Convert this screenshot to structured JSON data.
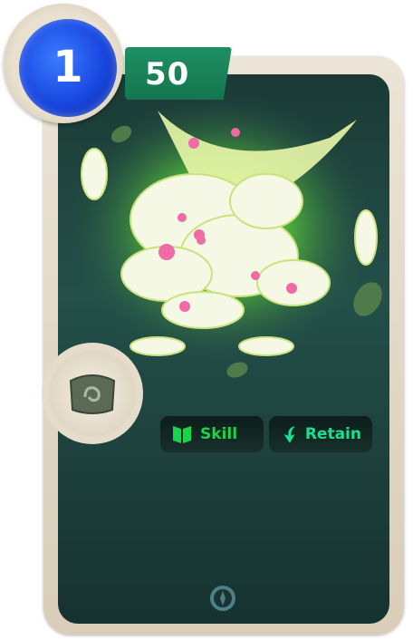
{
  "card": {
    "energy_cost": "1",
    "value": "50",
    "tags": [
      {
        "label": "Skill",
        "icon": "book-icon",
        "color": "#17d64a"
      },
      {
        "label": "Retain",
        "icon": "curved-arrow-down-icon",
        "color": "#19e08c"
      }
    ],
    "accent_colors": {
      "banner": "#1a8459",
      "orb": "#1c4ae6",
      "panel": "#245049"
    }
  }
}
